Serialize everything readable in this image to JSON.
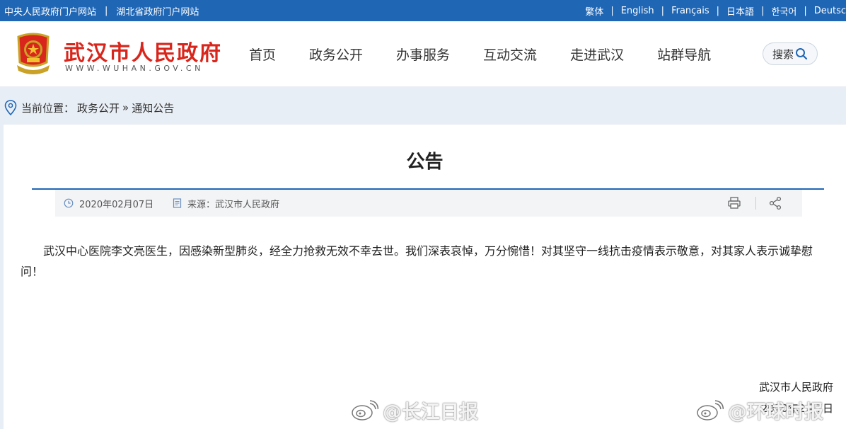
{
  "topbar": {
    "links_left": [
      "中央人民政府门户网站",
      "湖北省政府门户网站"
    ],
    "separator": "|",
    "languages": [
      "繁体",
      "English",
      "Français",
      "日本語",
      "한국어",
      "Deutsc"
    ]
  },
  "header": {
    "site_name": "武汉市人民政府",
    "site_url": "WWW.WUHAN.GOV.CN",
    "nav": [
      "首页",
      "政务公开",
      "办事服务",
      "互动交流",
      "走进武汉",
      "站群导航"
    ],
    "search_label": "搜索"
  },
  "breadcrumb": {
    "prefix": "当前位置：",
    "items": [
      "政务公开",
      "通知公告"
    ],
    "separator": "»"
  },
  "article": {
    "title": "公告",
    "date": "2020年02月07日",
    "source": "来源：武汉市人民政府",
    "body": "武汉中心医院李文亮医生，因感染新型肺炎，经全力抢救无效不幸去世。我们深表哀悼，万分惋惜！对其坚守一线抗击疫情表示敬意，对其家人表示诚挚慰问！",
    "signature_org": "武汉市人民政府",
    "signature_date": "2020年2月7日"
  },
  "watermarks": [
    "@长江日报",
    "@环球时报"
  ],
  "colors": {
    "topbar": "#1f66b5",
    "brand_red": "#d9261c",
    "page_bg": "#e8eef5"
  },
  "icons": [
    "emblem-icon",
    "search-icon",
    "location-pin-icon",
    "clock-icon",
    "document-icon",
    "print-icon",
    "share-icon",
    "weibo-icon"
  ]
}
